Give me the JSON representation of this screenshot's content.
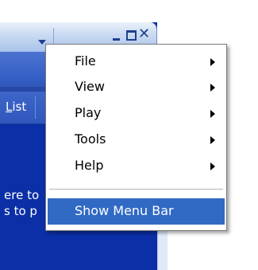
{
  "background_window": {
    "list_tab_label_underlined": "L",
    "list_tab_label_rest": "ist",
    "panel_text_line1": "ere to",
    "panel_text_line2": "s to p"
  },
  "context_menu": {
    "items": [
      {
        "label": "File",
        "has_submenu": true
      },
      {
        "label": "View",
        "has_submenu": true
      },
      {
        "label": "Play",
        "has_submenu": true
      },
      {
        "label": "Tools",
        "has_submenu": true
      },
      {
        "label": "Help",
        "has_submenu": true
      }
    ],
    "highlighted_item": {
      "label": "Show Menu Bar",
      "highlighted": true
    }
  },
  "colors": {
    "highlight": "#316ac5",
    "panel_blue": "#0b2fa6",
    "title_icon": "#1f3f8f"
  },
  "icons": {
    "title_dropdown": "chevron-down-icon",
    "minimize": "minimize-icon",
    "maximize": "maximize-icon",
    "close": "close-icon",
    "submenu": "submenu-arrow-icon"
  }
}
